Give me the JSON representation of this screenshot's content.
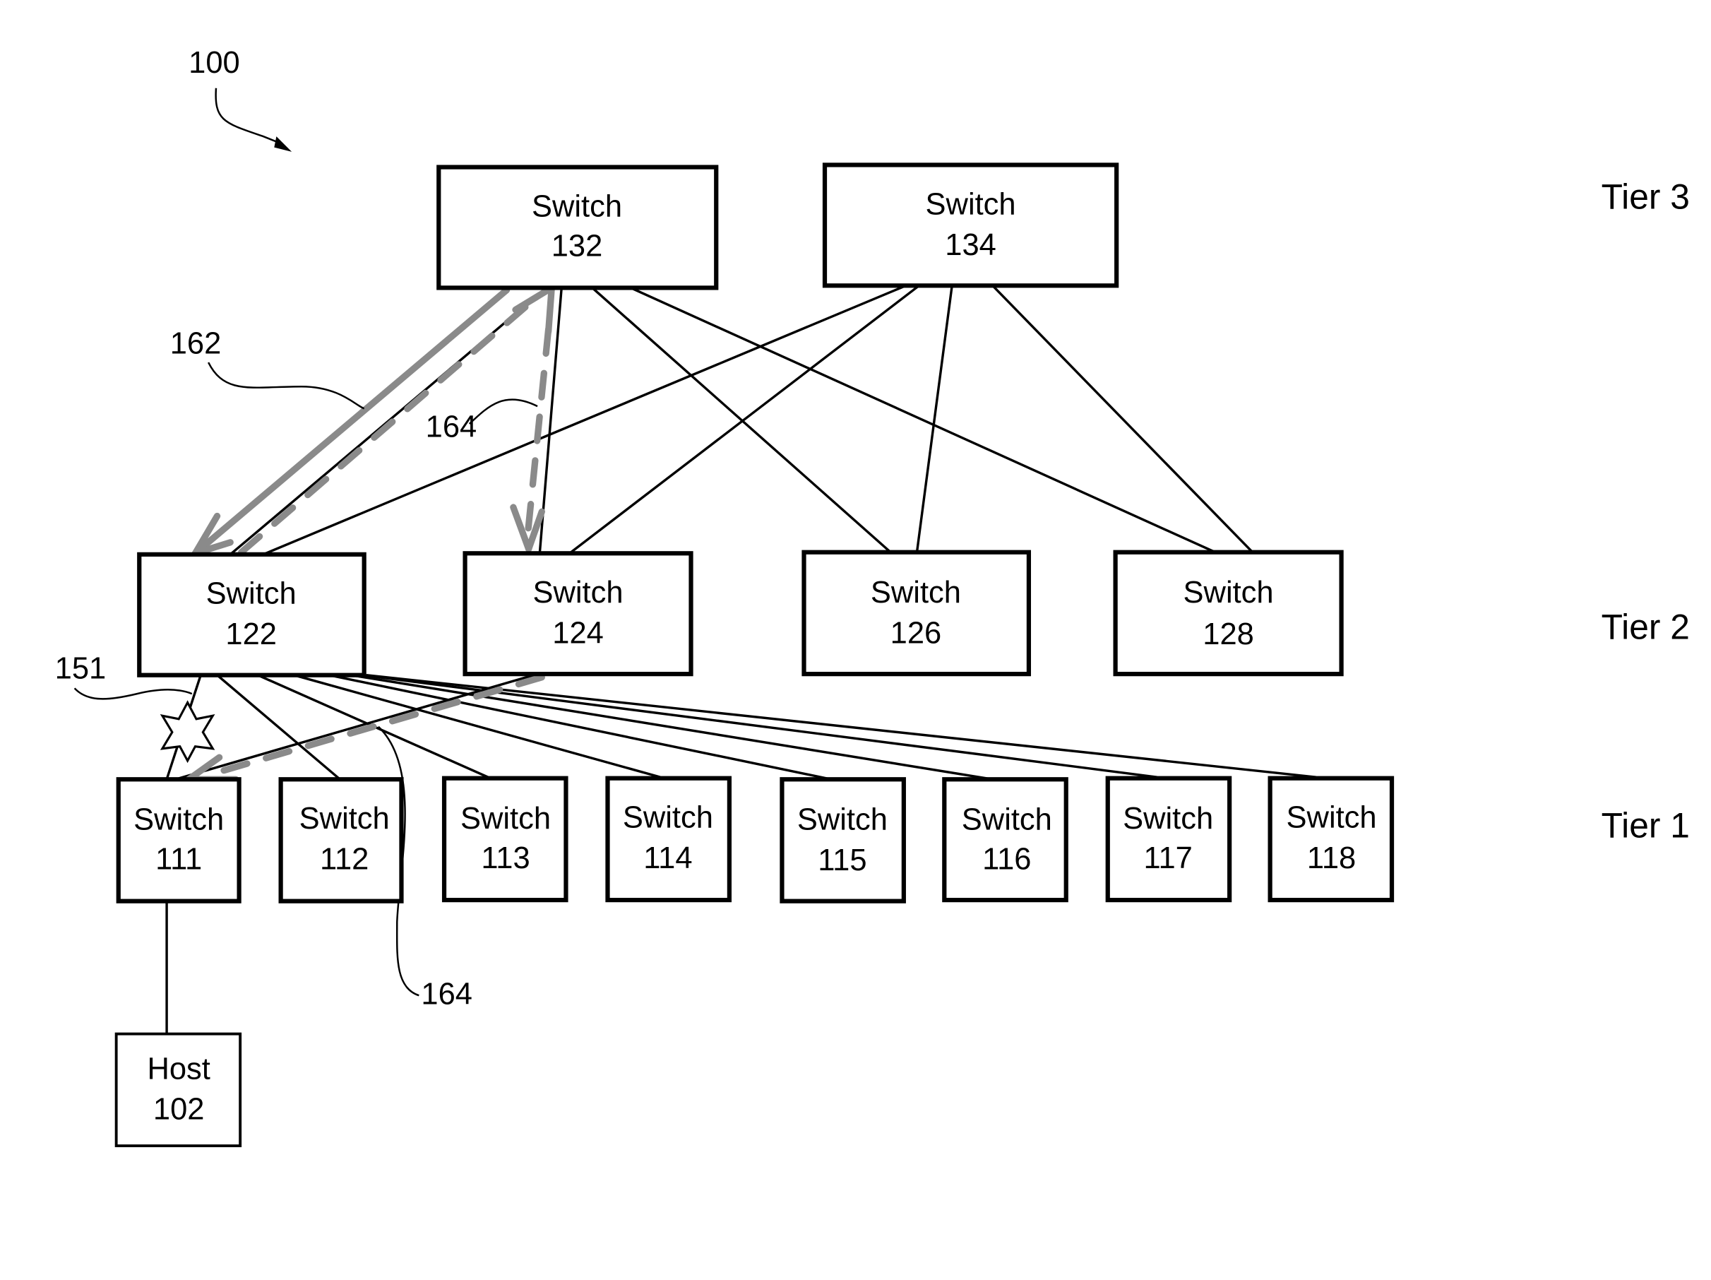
{
  "figure": {
    "reference": "100",
    "tiers": [
      {
        "label": "Tier 3"
      },
      {
        "label": "Tier 2"
      },
      {
        "label": "Tier 1"
      }
    ],
    "tier3": [
      {
        "line1": "Switch",
        "line2": "132"
      },
      {
        "line1": "Switch",
        "line2": "134"
      }
    ],
    "tier2": [
      {
        "line1": "Switch",
        "line2": "122"
      },
      {
        "line1": "Switch",
        "line2": "124"
      },
      {
        "line1": "Switch",
        "line2": "126"
      },
      {
        "line1": "Switch",
        "line2": "128"
      }
    ],
    "tier1": [
      {
        "line1": "Switch",
        "line2": "111"
      },
      {
        "line1": "Switch",
        "line2": "112"
      },
      {
        "line1": "Switch",
        "line2": "113"
      },
      {
        "line1": "Switch",
        "line2": "114"
      },
      {
        "line1": "Switch",
        "line2": "115"
      },
      {
        "line1": "Switch",
        "line2": "116"
      },
      {
        "line1": "Switch",
        "line2": "117"
      },
      {
        "line1": "Switch",
        "line2": "118"
      }
    ],
    "host": {
      "line1": "Host",
      "line2": "102"
    },
    "callouts": {
      "path_162": "162",
      "path_164_upper": "164",
      "path_164_lower": "164",
      "failure_151": "151"
    },
    "colors": {
      "path": "#8a8a8a",
      "line": "#000000"
    }
  }
}
